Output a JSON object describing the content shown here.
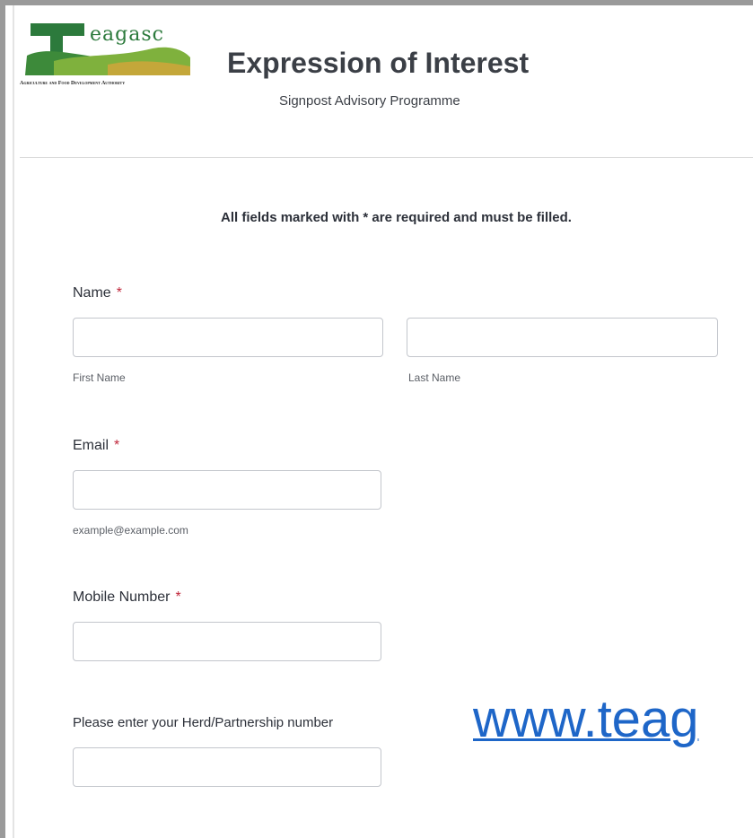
{
  "header": {
    "logo_word": "eagasc",
    "logo_tagline": "Agriculture and Food Development Authority",
    "title": "Expression of Interest",
    "subtitle": "Signpost Advisory Programme"
  },
  "form": {
    "required_note": "All fields marked with * are required and must be filled.",
    "required_mark": "*",
    "name": {
      "label": "Name",
      "first_value": "",
      "last_value": "",
      "first_sublabel": "First Name",
      "last_sublabel": "Last Name"
    },
    "email": {
      "label": "Email",
      "value": "",
      "sublabel": "example@example.com"
    },
    "mobile": {
      "label": "Mobile Number",
      "value": ""
    },
    "herd": {
      "label": "Please enter your Herd/Partnership number",
      "value": ""
    }
  },
  "overlay": {
    "website_text": "www.teag"
  },
  "colors": {
    "brand_green": "#2c7a3c",
    "required_red": "#c0273b",
    "link_blue": "#1e66c8"
  }
}
